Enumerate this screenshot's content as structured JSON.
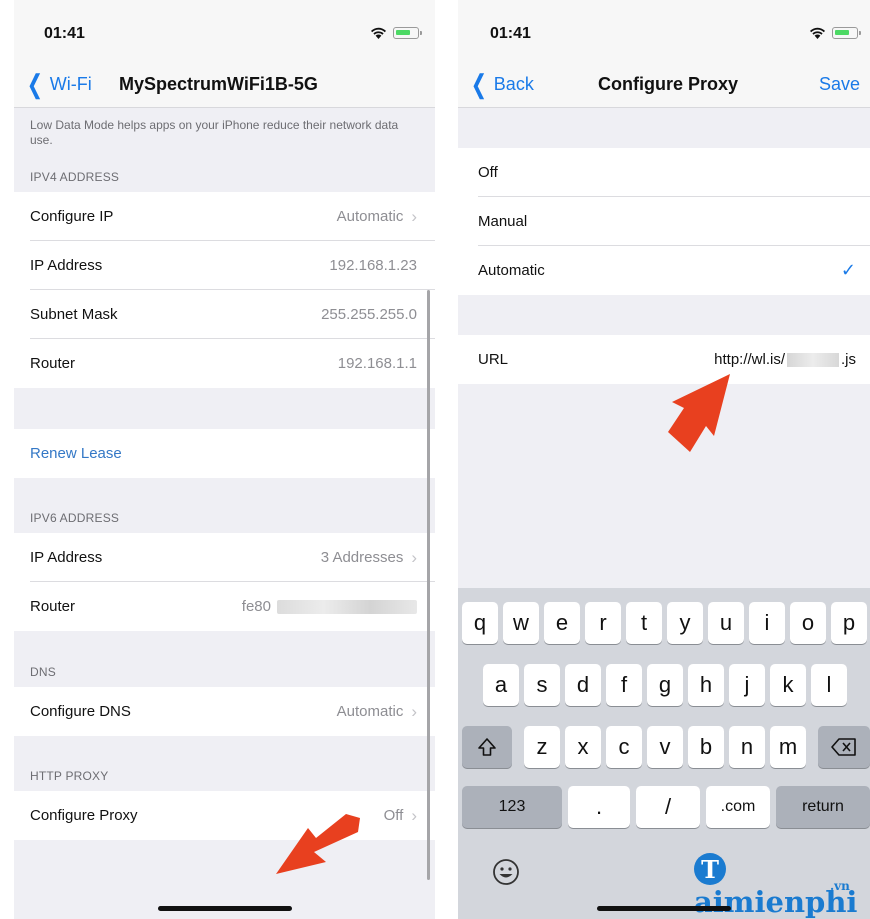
{
  "left": {
    "status": {
      "time": "01:41"
    },
    "nav": {
      "back_label": "Wi-Fi",
      "title": "MySpectrumWiFi1B-5G"
    },
    "low_data_note": "Low Data Mode helps apps on your iPhone reduce their network data use.",
    "ipv4": {
      "header": "IPV4 ADDRESS",
      "rows": [
        {
          "label": "Configure IP",
          "value": "Automatic"
        },
        {
          "label": "IP Address",
          "value": "192.168.1.23"
        },
        {
          "label": "Subnet Mask",
          "value": "255.255.255.0"
        },
        {
          "label": "Router",
          "value": "192.168.1.1"
        }
      ]
    },
    "renew_lease": "Renew Lease",
    "ipv6": {
      "header": "IPV6 ADDRESS",
      "rows": [
        {
          "label": "IP Address",
          "value": "3 Addresses"
        },
        {
          "label": "Router",
          "value": "fe80"
        }
      ]
    },
    "dns": {
      "header": "DNS",
      "row": {
        "label": "Configure DNS",
        "value": "Automatic"
      }
    },
    "http_proxy": {
      "header": "HTTP PROXY",
      "row": {
        "label": "Configure Proxy",
        "value": "Off"
      }
    }
  },
  "right": {
    "status": {
      "time": "01:41"
    },
    "nav": {
      "back_label": "Back",
      "title": "Configure Proxy",
      "save_label": "Save"
    },
    "options": [
      {
        "label": "Off"
      },
      {
        "label": "Manual"
      },
      {
        "label": "Automatic",
        "checked": true
      }
    ],
    "url": {
      "label": "URL",
      "prefix": "http://wl.is/",
      "suffix": ".js"
    },
    "keyboard": {
      "row1": [
        "q",
        "w",
        "e",
        "r",
        "t",
        "y",
        "u",
        "i",
        "o",
        "p"
      ],
      "row2": [
        "a",
        "s",
        "d",
        "f",
        "g",
        "h",
        "j",
        "k",
        "l"
      ],
      "row3": [
        "z",
        "x",
        "c",
        "v",
        "b",
        "n",
        "m"
      ],
      "row4": {
        "numbers": "123",
        "dot": ".",
        "slash": "/",
        "dotcom": ".com",
        "return": "return"
      }
    }
  },
  "watermark": {
    "letter": "T",
    "text": "aimienphi",
    "suffix": ".vn"
  },
  "colors": {
    "accent": "#1a7ae8",
    "arrow": "#e8401f",
    "watermark": "#1a7bd0"
  }
}
